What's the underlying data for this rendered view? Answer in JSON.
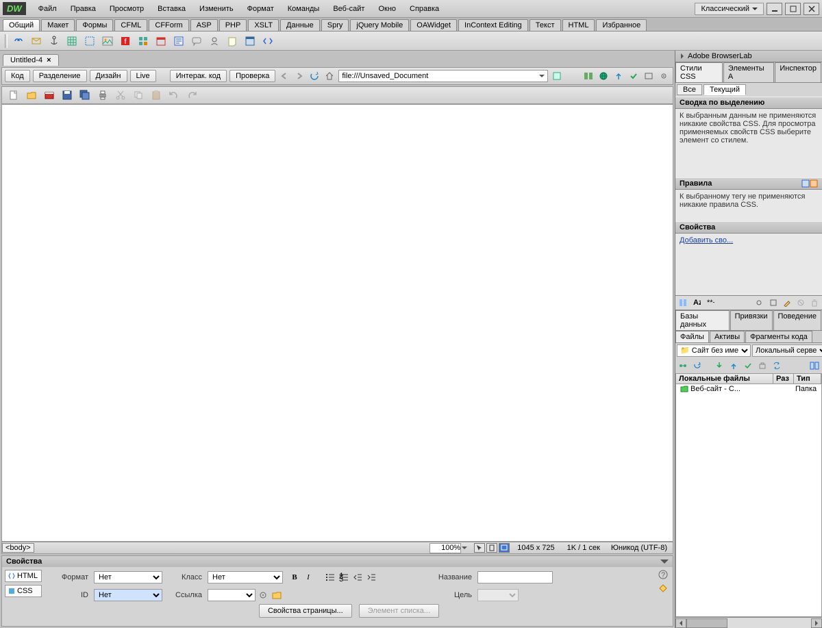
{
  "menubar": {
    "logo": "DW",
    "items": [
      "Файл",
      "Правка",
      "Просмотр",
      "Вставка",
      "Изменить",
      "Формат",
      "Команды",
      "Веб-сайт",
      "Окно",
      "Справка"
    ],
    "workspace": "Классический"
  },
  "category_tabs": [
    "Общий",
    "Макет",
    "Формы",
    "CFML",
    "CFForm",
    "ASP",
    "PHP",
    "XSLT",
    "Данные",
    "Spry",
    "jQuery Mobile",
    "OAWidget",
    "InContext Editing",
    "Текст",
    "HTML",
    "Избранное"
  ],
  "doc": {
    "name": "Untitled-4"
  },
  "viewbar": {
    "code": "Код",
    "split": "Разделение",
    "design": "Дизайн",
    "live": "Live",
    "livecode": "Интерак. код",
    "inspect": "Проверка",
    "url": "file:///Unsaved_Document"
  },
  "status": {
    "tag": "<body>",
    "zoom": "100%",
    "dims": "1045 x 725",
    "size": "1K / 1 сек",
    "enc": "Юникод (UTF-8)"
  },
  "propanel": {
    "title": "Свойства",
    "mode_html": "HTML",
    "mode_css": "CSS",
    "format_lbl": "Формат",
    "format_val": "Нет",
    "class_lbl": "Класс",
    "class_val": "Нет",
    "id_lbl": "ID",
    "id_val": "Нет",
    "link_lbl": "Ссылка",
    "title_lbl": "Название",
    "target_lbl": "Цель",
    "page_props_btn": "Свойства страницы...",
    "list_item_btn": "Элемент списка..."
  },
  "side": {
    "browserlab": "Adobe BrowserLab",
    "css_tabs": [
      "Стили CSS",
      "Элементы A",
      "Инспектор"
    ],
    "css_sub": [
      "Все",
      "Текущий"
    ],
    "summary_hdr": "Сводка по выделению",
    "summary_txt": "К выбранным данным не применяются никакие свойства CSS.  Для просмотра применяемых свойств CSS выберите элемент со стилем.",
    "rules_hdr": "Правила",
    "rules_txt": "К выбранному тегу не применяются никакие правила CSS.",
    "props_hdr": "Свойства",
    "add_prop": "Добавить сво...",
    "data_tabs": [
      "Базы данных",
      "Привязки",
      "Поведение"
    ],
    "files_tabs": [
      "Файлы",
      "Активы",
      "Фрагменты кода"
    ],
    "site_sel": "Сайт без име",
    "view_sel": "Локальный серве",
    "files_cols": {
      "name": "Локальные файлы",
      "size": "Раз",
      "type": "Тип"
    },
    "file_row": {
      "name": "Веб-сайт - С...",
      "type": "Папка"
    }
  }
}
